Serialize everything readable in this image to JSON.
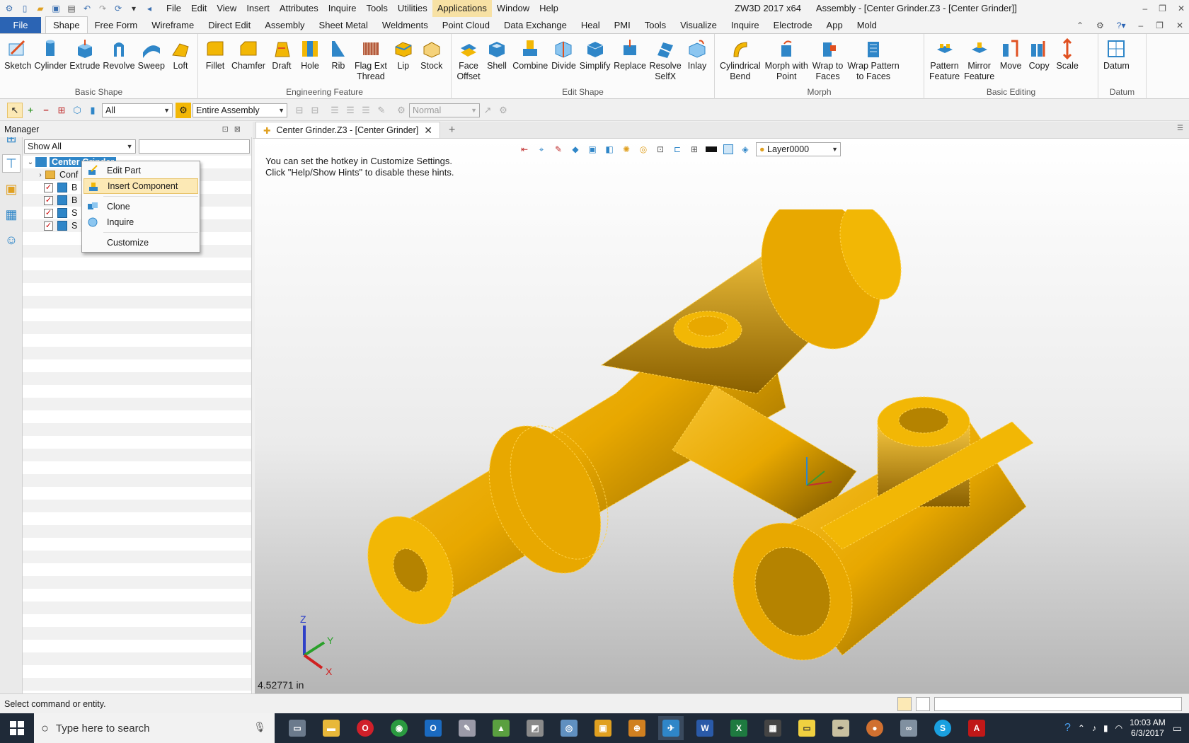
{
  "app": {
    "window_title": "ZW3D 2017 x64",
    "doc_title": "Assembly - [Center Grinder.Z3 - [Center Grinder]]"
  },
  "menubar": [
    "File",
    "Edit",
    "View",
    "Insert",
    "Attributes",
    "Inquire",
    "Tools",
    "Utilities",
    "Applications",
    "Window",
    "Help"
  ],
  "ribbon_tabs": [
    "File",
    "Shape",
    "Free Form",
    "Wireframe",
    "Direct Edit",
    "Assembly",
    "Sheet Metal",
    "Weldments",
    "Point Cloud",
    "Data Exchange",
    "Heal",
    "PMI",
    "Tools",
    "Visualize",
    "Inquire",
    "Electrode",
    "App",
    "Mold"
  ],
  "active_tab": "Shape",
  "ribbon_groups": [
    {
      "label": "Basic Shape",
      "buttons": [
        "Sketch",
        "Cylinder",
        "Extrude",
        "Revolve",
        "Sweep",
        "Loft"
      ]
    },
    {
      "label": "Engineering Feature",
      "buttons": [
        "Fillet",
        "Chamfer",
        "Draft",
        "Hole",
        "Rib",
        "Flag Ext\nThread",
        "Lip",
        "Stock"
      ]
    },
    {
      "label": "Edit Shape",
      "buttons": [
        "Face\nOffset",
        "Shell",
        "Combine",
        "Divide",
        "Simplify",
        "Replace",
        "Resolve\nSelfX",
        "Inlay"
      ]
    },
    {
      "label": "Morph",
      "buttons": [
        "Cylindrical\nBend",
        "Morph with\nPoint",
        "Wrap to\nFaces",
        "Wrap Pattern\nto Faces"
      ]
    },
    {
      "label": "Basic Editing",
      "buttons": [
        "Pattern\nFeature",
        "Mirror\nFeature",
        "Move",
        "Copy",
        "Scale"
      ]
    },
    {
      "label": "Datum",
      "buttons": [
        "Datum"
      ]
    }
  ],
  "toolbar": {
    "filter_value": "All",
    "scope_value": "Entire Assembly",
    "mode_value": "Normal"
  },
  "manager": {
    "title": "Manager",
    "filter_value": "Show All",
    "tree": {
      "root": "Center Grinder",
      "config": "Conf",
      "items": [
        "B",
        "B",
        "S",
        "S"
      ]
    }
  },
  "context_menu": {
    "items": [
      "Edit Part",
      "Insert Component",
      "Clone",
      "Inquire",
      "Customize"
    ],
    "highlighted": "Insert Component"
  },
  "doc_tab": {
    "label": "Center Grinder.Z3 - [Center Grinder]"
  },
  "viewport": {
    "hint_line1": "You can set the hotkey in Customize Settings.",
    "hint_line2": "Click \"Help/Show Hints\" to disable these hints.",
    "layer": "Layer0000",
    "measure": "4.52771 in",
    "axis_labels": {
      "x": "X",
      "y": "Y",
      "z": "Z"
    }
  },
  "status": {
    "prompt": "Select command or entity."
  },
  "taskbar": {
    "search_placeholder": "Type here to search",
    "time": "10:03 AM",
    "date": "6/3/2017"
  },
  "colors": {
    "model": "#f2b705",
    "file_tab": "#2b64b4",
    "taskbar": "#1f2a38"
  }
}
